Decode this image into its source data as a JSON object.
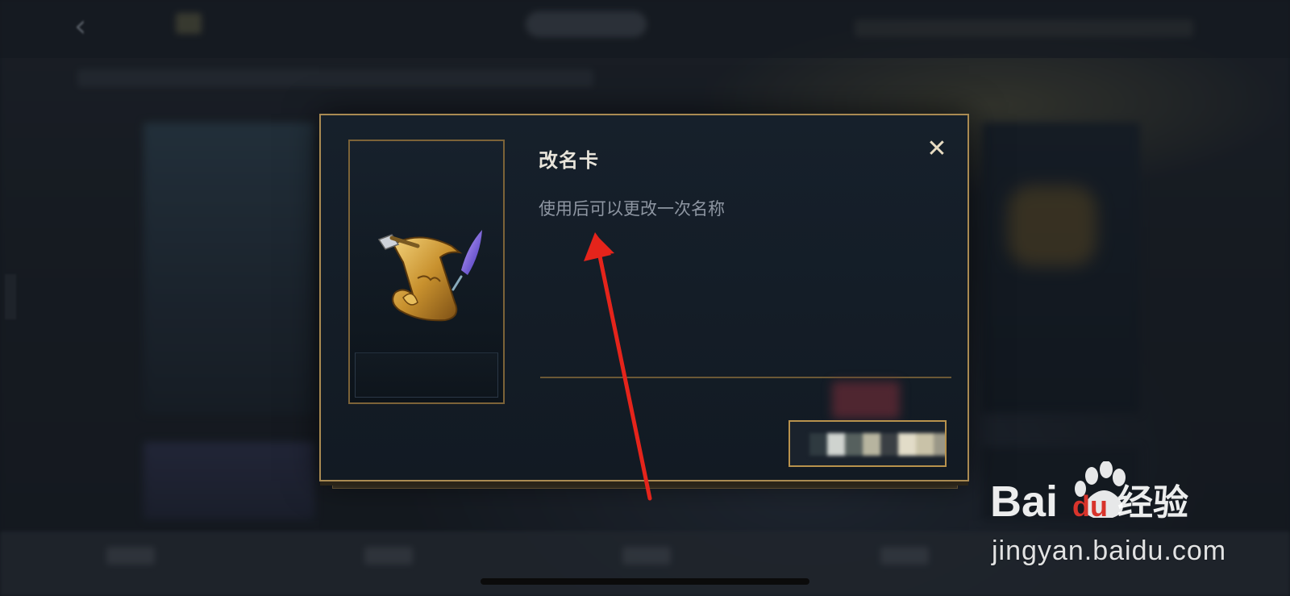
{
  "dialog": {
    "title": "改名卡",
    "description": "使用后可以更改一次名称",
    "close_glyph": "✕",
    "item_icon": "scroll-quill-icon",
    "action_button_label": ""
  },
  "watermark": {
    "brand": "Baidu经验",
    "url": "jingyan.baidu.com"
  },
  "colors": {
    "modal_border": "#a98a52",
    "title": "#e8e4da",
    "description": "#8e96a2",
    "arrow": "#e5241b"
  }
}
